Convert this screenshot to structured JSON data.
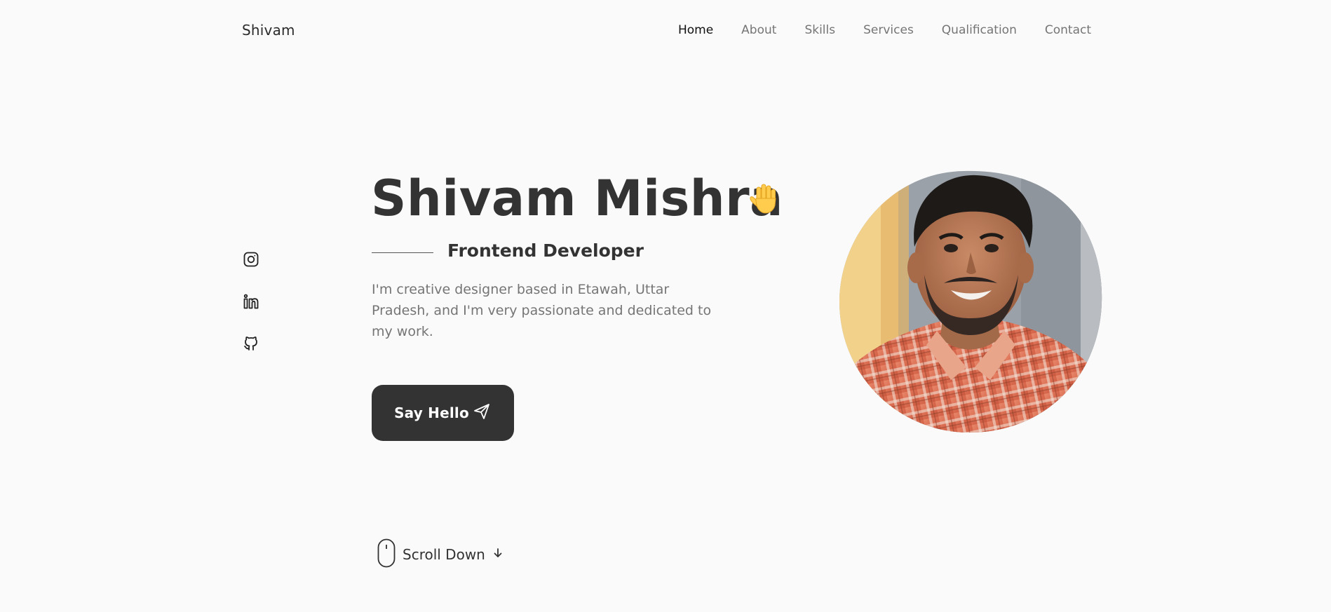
{
  "header": {
    "logo": "Shivam",
    "nav": [
      {
        "label": "Home",
        "active": true
      },
      {
        "label": "About"
      },
      {
        "label": "Skills"
      },
      {
        "label": "Services"
      },
      {
        "label": "Qualification"
      },
      {
        "label": "Contact"
      }
    ]
  },
  "social": {
    "icons": [
      "instagram-icon",
      "linkedin-icon",
      "github-icon"
    ]
  },
  "hero": {
    "name": "Shivam Mishra",
    "wave_icon": "waving-hand-icon",
    "title": "Frontend Developer",
    "description": "I'm creative designer based in Etawah, Uttar Pradesh, and I'm very passionate and dedicated to my work.",
    "cta_label": "Say Hello",
    "cta_icon": "send-icon"
  },
  "scroll": {
    "label": "Scroll Down",
    "mouse_icon": "mouse-icon",
    "arrow_icon": "arrow-down-icon"
  },
  "colors": {
    "background": "#fafafa",
    "primary": "#333333",
    "muted": "#757575",
    "blob_accent": "#f2d18b"
  }
}
